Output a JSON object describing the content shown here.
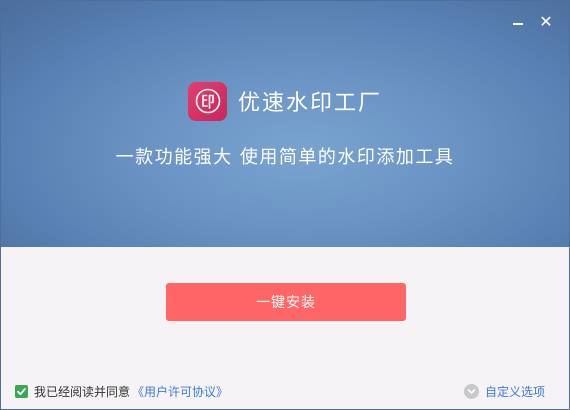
{
  "window": {
    "minimize_icon": "minimize-icon",
    "close_icon": "close-icon",
    "close_glyph": "✕"
  },
  "hero": {
    "app_name": "优速水印工厂",
    "tagline": "一款功能强大 使用简单的水印添加工具",
    "logo_glyph": "印",
    "colors": {
      "gradient_center": "#79a3cf",
      "gradient_edge": "#4a6d9d",
      "logo": "#d93366"
    }
  },
  "actions": {
    "install_label": "一键安装",
    "install_color": "#ff6665"
  },
  "footer": {
    "agree_text": "我已经阅读并同意",
    "license_link": "《用户许可协议》",
    "agree_checked": true,
    "custom_options": "自定义选项",
    "link_color": "#3d7ad6"
  }
}
